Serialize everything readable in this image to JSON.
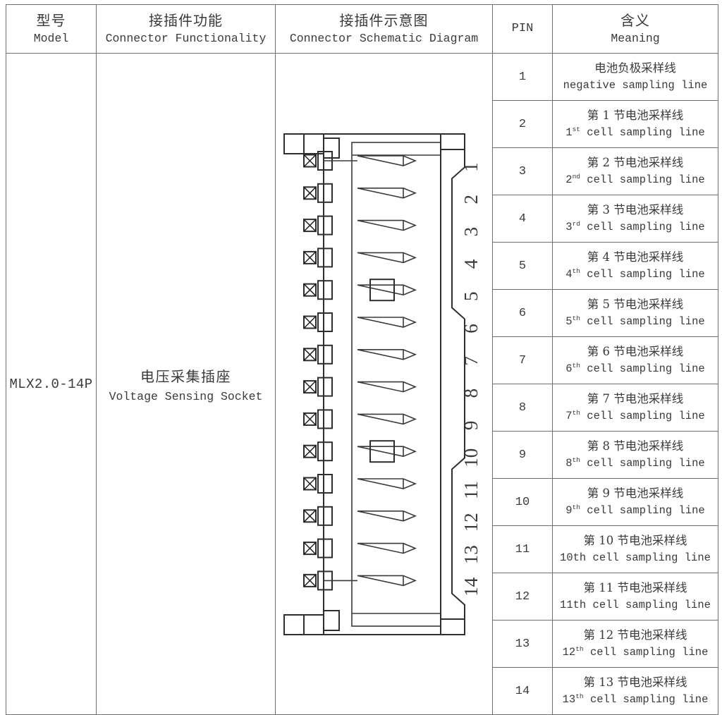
{
  "table": {
    "headers": [
      {
        "cn": "型号",
        "en": "Model"
      },
      {
        "cn": "接插件功能",
        "en": "Connector  Functionality"
      },
      {
        "cn": "接插件示意图",
        "en": "Connector  Schematic  Diagram"
      },
      {
        "cn": "",
        "en": "PIN"
      },
      {
        "cn": "含义",
        "en": "Meaning"
      }
    ],
    "model": "MLX2.0-14P",
    "function": {
      "cn": "电压采集插座",
      "en": "Voltage  Sensing  Socket"
    },
    "rows": [
      {
        "pin": "1",
        "cn": "电池负极采样线",
        "en_pre": "negative sampling line",
        "en_sup": "",
        "en_post": ""
      },
      {
        "pin": "2",
        "cn": "第 1 节电池采样线",
        "en_pre": "1",
        "en_sup": "st",
        "en_post": " cell sampling line"
      },
      {
        "pin": "3",
        "cn": "第 2 节电池采样线",
        "en_pre": "2",
        "en_sup": "nd",
        "en_post": " cell sampling line"
      },
      {
        "pin": "4",
        "cn": "第 3 节电池采样线",
        "en_pre": "3",
        "en_sup": "rd",
        "en_post": " cell sampling line"
      },
      {
        "pin": "5",
        "cn": "第 4 节电池采样线",
        "en_pre": "4",
        "en_sup": "th",
        "en_post": " cell sampling line"
      },
      {
        "pin": "6",
        "cn": "第 5 节电池采样线",
        "en_pre": "5",
        "en_sup": "th",
        "en_post": " cell sampling line"
      },
      {
        "pin": "7",
        "cn": "第 6 节电池采样线",
        "en_pre": "6",
        "en_sup": "th",
        "en_post": " cell sampling line"
      },
      {
        "pin": "8",
        "cn": "第 7 节电池采样线",
        "en_pre": "7",
        "en_sup": "th",
        "en_post": " cell sampling line"
      },
      {
        "pin": "9",
        "cn": "第 8 节电池采样线",
        "en_pre": "8",
        "en_sup": "th",
        "en_post": " cell sampling line"
      },
      {
        "pin": "10",
        "cn": "第 9 节电池采样线",
        "en_pre": "9",
        "en_sup": "th",
        "en_post": " cell sampling line"
      },
      {
        "pin": "11",
        "cn": "第 10 节电池采样线",
        "en_pre": "10th cell sampling line",
        "en_sup": "",
        "en_post": ""
      },
      {
        "pin": "12",
        "cn": "第 11 节电池采样线",
        "en_pre": "11th cell sampling line",
        "en_sup": "",
        "en_post": ""
      },
      {
        "pin": "13",
        "cn": "第 12 节电池采样线",
        "en_pre": "12",
        "en_sup": "th",
        "en_post": " cell sampling line"
      },
      {
        "pin": "14",
        "cn": "第 13 节电池采样线",
        "en_pre": "13",
        "en_sup": "th",
        "en_post": " cell  sampling line"
      }
    ]
  },
  "diagram": {
    "pin_labels": [
      "1",
      "2",
      "3",
      "4",
      "5",
      "6",
      "7",
      "8",
      "9",
      "10",
      "11",
      "12",
      "13",
      "14"
    ],
    "pin_count": 14,
    "latch_pins": [
      5,
      10
    ],
    "stroke_color": "#2e2e2e"
  }
}
